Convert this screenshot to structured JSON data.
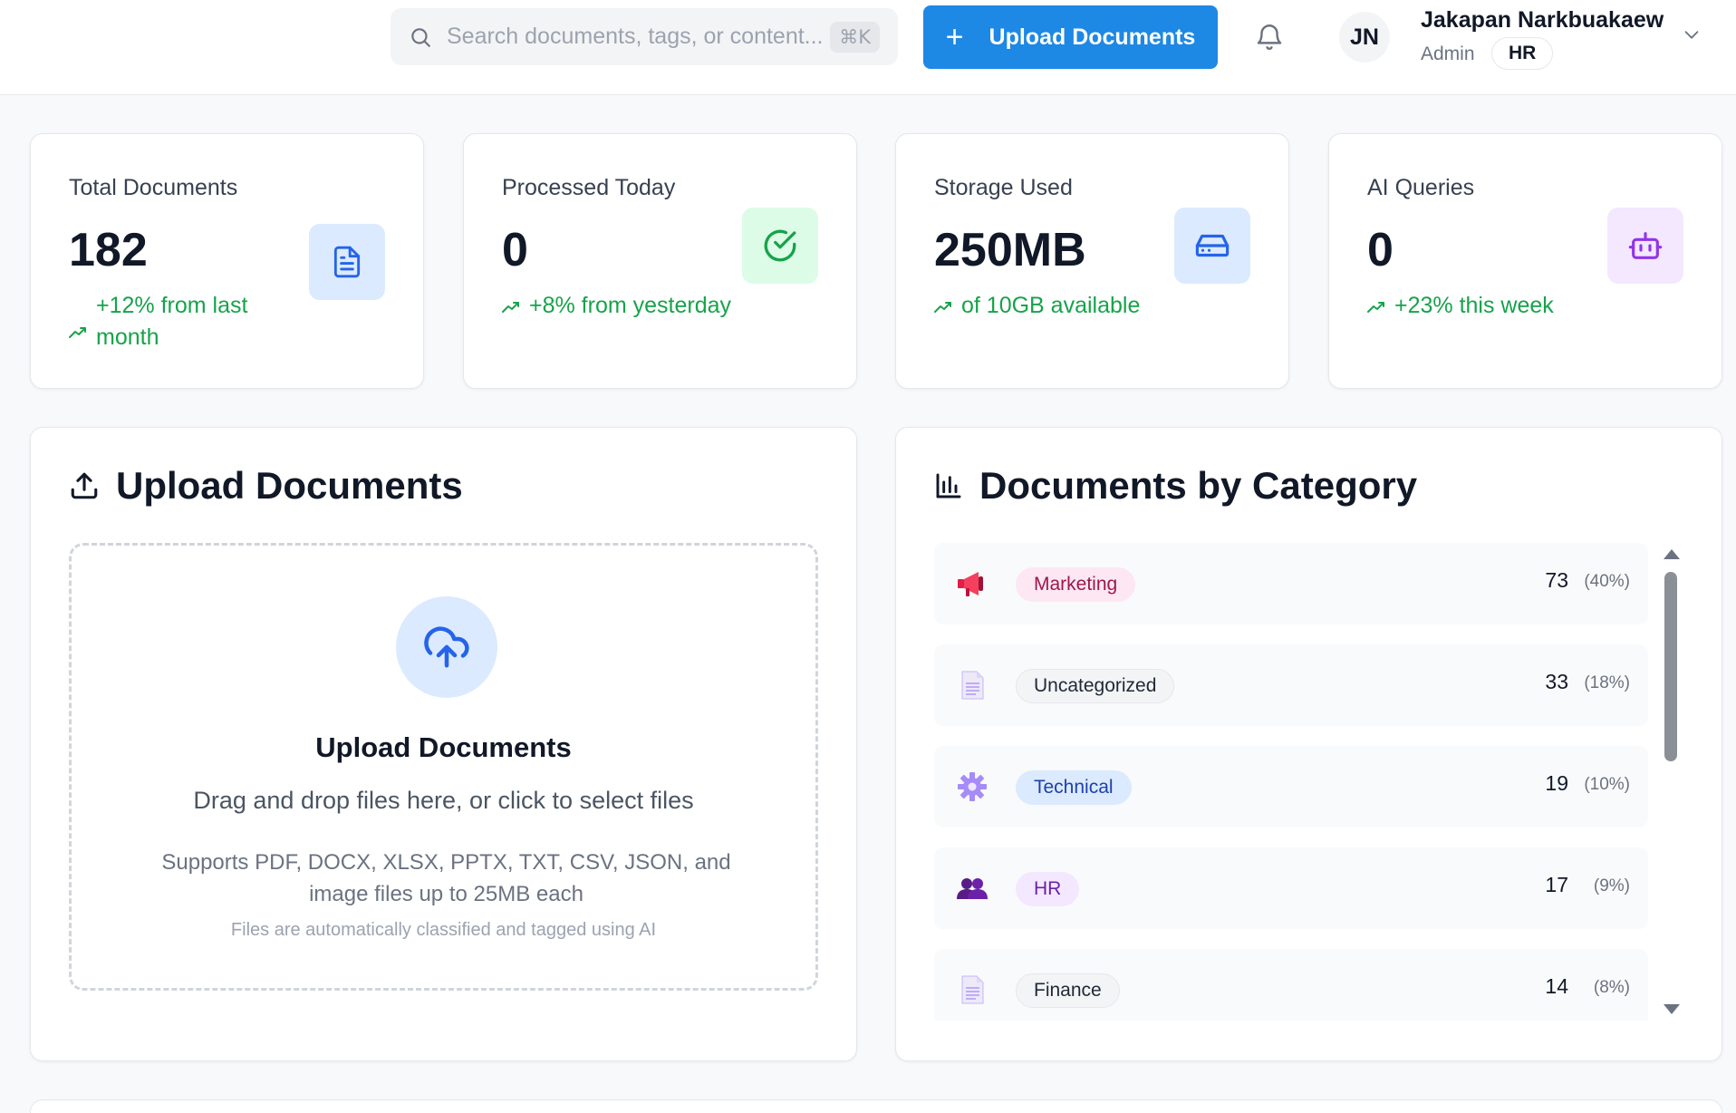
{
  "header": {
    "search": {
      "placeholder": "Search documents, tags, or content...",
      "shortcut": "⌘K",
      "icon": "search-icon"
    },
    "upload_button": {
      "icon": "plus",
      "label": "Upload Documents"
    },
    "notifications_icon": "bell-icon",
    "user": {
      "initials": "JN",
      "name": "Jakapan Narkbuakaew",
      "role": "Admin",
      "department": "HR"
    },
    "menu_icon": "chevron-down-icon"
  },
  "stats": [
    {
      "label": "Total Documents",
      "value": "182",
      "trend": "+12% from last month",
      "icon": "document-icon",
      "icon_bg": "#dbeafe",
      "icon_color": "#2563eb"
    },
    {
      "label": "Processed Today",
      "value": "0",
      "trend": "+8% from yesterday",
      "icon": "check-circle-icon",
      "icon_bg": "#dcfce7",
      "icon_color": "#16a34a"
    },
    {
      "label": "Storage Used",
      "value": "250MB",
      "trend": "of 10GB available",
      "icon": "hard-drive-icon",
      "icon_bg": "#dbeafe",
      "icon_color": "#2563eb"
    },
    {
      "label": "AI Queries",
      "value": "0",
      "trend": "+23% this week",
      "icon": "bot-icon",
      "icon_bg": "#f3e8ff",
      "icon_color": "#9333ea"
    }
  ],
  "upload_panel": {
    "title": "Upload Documents",
    "dropzone": {
      "title": "Upload Documents",
      "subtitle": "Drag and drop files here, or click to select files",
      "supported": "Supports PDF, DOCX, XLSX, PPTX, TXT, CSV, JSON, and image files up to 25MB each",
      "note": "Files are automatically classified and tagged using AI"
    }
  },
  "category_panel": {
    "title": "Documents by Category",
    "categories": [
      {
        "name": "Marketing",
        "count": "73",
        "percent": "(40%)",
        "icon": "megaphone-icon",
        "tag_bg": "#fce7f3",
        "tag_color": "#9d174d"
      },
      {
        "name": "Uncategorized",
        "count": "33",
        "percent": "(18%)",
        "icon": "page-icon",
        "tag_bg": "#f3f4f6",
        "tag_color": "#1f2937"
      },
      {
        "name": "Technical",
        "count": "19",
        "percent": "(10%)",
        "icon": "gear-icon",
        "tag_bg": "#dbeafe",
        "tag_color": "#1e40af"
      },
      {
        "name": "HR",
        "count": "17",
        "percent": "(9%)",
        "icon": "people-icon",
        "tag_bg": "#f3e8ff",
        "tag_color": "#6b21a8"
      },
      {
        "name": "Finance",
        "count": "14",
        "percent": "(8%)",
        "icon": "page-icon",
        "tag_bg": "#f3f4f6",
        "tag_color": "#1f2937"
      }
    ]
  }
}
